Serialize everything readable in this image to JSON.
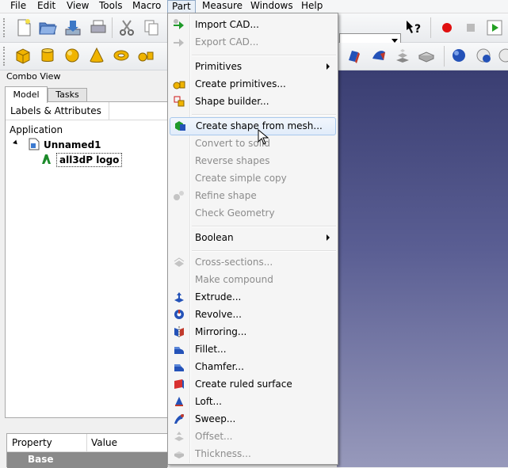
{
  "menubar": {
    "items": [
      "File",
      "Edit",
      "View",
      "Tools",
      "Macro",
      "Part",
      "Measure",
      "Windows",
      "Help"
    ],
    "active": "Part"
  },
  "combo_view": {
    "title": "Combo View",
    "tabs": [
      "Model",
      "Tasks"
    ],
    "active_tab": "Model",
    "tree_header": "Labels & Attributes",
    "tree": {
      "root": "Application",
      "document": "Unnamed1",
      "object": "all3dP logo"
    },
    "property_headers": [
      "Property",
      "Value"
    ],
    "property_group": "Base"
  },
  "part_menu": {
    "items": [
      {
        "label": "Import CAD...",
        "enabled": true,
        "icon": "import-cad-icon"
      },
      {
        "label": "Export CAD...",
        "enabled": false,
        "icon": "export-cad-icon"
      },
      {
        "label": "Primitives",
        "enabled": true,
        "submenu": true
      },
      {
        "label": "Create primitives...",
        "enabled": true,
        "icon": "create-primitives-icon"
      },
      {
        "label": "Shape builder...",
        "enabled": true,
        "icon": "shape-builder-icon"
      },
      {
        "label": "Create shape from mesh...",
        "enabled": true,
        "icon": "shape-from-mesh-icon",
        "highlighted": true
      },
      {
        "label": "Convert to solid",
        "enabled": false
      },
      {
        "label": "Reverse shapes",
        "enabled": false
      },
      {
        "label": "Create simple copy",
        "enabled": false
      },
      {
        "label": "Refine shape",
        "enabled": false,
        "icon": "refine-shape-icon"
      },
      {
        "label": "Check Geometry",
        "enabled": false
      },
      {
        "label": "Boolean",
        "enabled": true,
        "submenu": true
      },
      {
        "label": "Cross-sections...",
        "enabled": false,
        "icon": "cross-sections-icon"
      },
      {
        "label": "Make compound",
        "enabled": false
      },
      {
        "label": "Extrude...",
        "enabled": true,
        "icon": "extrude-icon"
      },
      {
        "label": "Revolve...",
        "enabled": true,
        "icon": "revolve-icon"
      },
      {
        "label": "Mirroring...",
        "enabled": true,
        "icon": "mirroring-icon"
      },
      {
        "label": "Fillet...",
        "enabled": true,
        "icon": "fillet-icon"
      },
      {
        "label": "Chamfer...",
        "enabled": true,
        "icon": "chamfer-icon"
      },
      {
        "label": "Create ruled surface",
        "enabled": true,
        "icon": "ruled-surface-icon"
      },
      {
        "label": "Loft...",
        "enabled": true,
        "icon": "loft-icon"
      },
      {
        "label": "Sweep...",
        "enabled": true,
        "icon": "sweep-icon"
      },
      {
        "label": "Offset...",
        "enabled": false,
        "icon": "offset-icon"
      },
      {
        "label": "Thickness...",
        "enabled": false,
        "icon": "thickness-icon"
      }
    ]
  },
  "colors": {
    "view_top": "#3a3e72",
    "view_bottom": "#9799bb",
    "menu_highlight_border": "#a8c8ec",
    "disabled_text": "#8c8c8c"
  }
}
